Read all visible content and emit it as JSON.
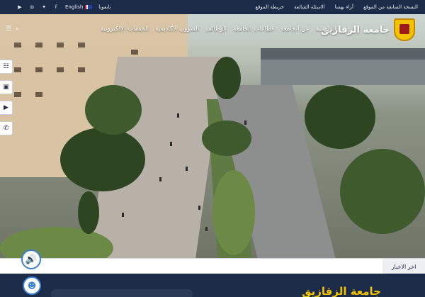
{
  "topbar": {
    "social_icons": [
      "youtube-icon",
      "instagram-icon",
      "twitter-icon",
      "facebook-icon"
    ],
    "language_label": "English",
    "follow_label": "تابعونا",
    "links": [
      "النسخة السابقة من الموقع",
      "أراء يهمنا",
      "الاسئلة الشائعة",
      "خريطة الموقع"
    ]
  },
  "header": {
    "brand_name": "جامعة الزقازيق",
    "menu": [
      "الرئيسية",
      "عن الجامعة",
      "قطاعات الجامعة",
      "الوظائف",
      "الشؤون الاكاديمية",
      "الخدمات الالكترونية"
    ]
  },
  "side_buttons": [
    "news-icon",
    "briefcase-icon",
    "youtube-icon",
    "phone-icon"
  ],
  "ticker": {
    "label": "اخر الاخبار"
  },
  "bottom": {
    "title": "جامعة الزقازيق"
  },
  "colors": {
    "navy": "#1c2b47",
    "gold": "#f2c300",
    "accent": "#3d7fd1"
  }
}
